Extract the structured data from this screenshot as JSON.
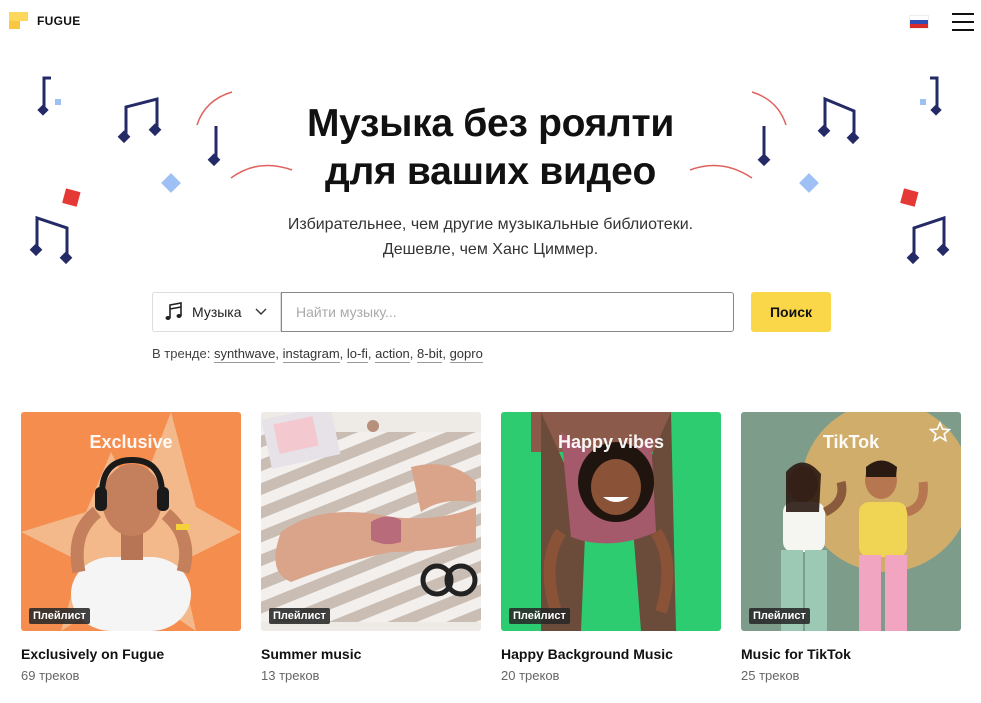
{
  "header": {
    "logo_text": "FUGUE",
    "flag_icon": "russia-flag-icon",
    "menu_icon": "hamburger-menu-icon"
  },
  "hero": {
    "title_line1": "Музыка без роялти",
    "title_line2": "для ваших видео",
    "subtitle_line1": "Избирательнее, чем другие музыкальные библиотеки.",
    "subtitle_line2": "Дешевле, чем Ханс Циммер."
  },
  "search": {
    "category_label": "Музыка",
    "category_icon": "music-note-icon",
    "placeholder": "Найти музыку...",
    "value": "",
    "button_label": "Поиск"
  },
  "trending": {
    "label": "В тренде:",
    "tags": [
      "synthwave",
      "instagram",
      "lo-fi",
      "action",
      "8-bit",
      "gopro"
    ]
  },
  "cards": [
    {
      "overlay": "Exclusive",
      "tag": "Плейлист",
      "title": "Exclusively on Fugue",
      "count": "69 треков"
    },
    {
      "overlay": "",
      "tag": "Плейлист",
      "title": "Summer music",
      "count": "13 треков"
    },
    {
      "overlay": "Happy vibes",
      "tag": "Плейлист",
      "title": "Happy Background Music",
      "count": "20 треков"
    },
    {
      "overlay": "TikTok",
      "tag": "Плейлист",
      "title": "Music for TikTok",
      "count": "25 треков"
    }
  ],
  "colors": {
    "accent_yellow": "#f9d748",
    "navy_note": "#232a66",
    "red_shape": "#e53935",
    "light_blue_shape": "#9fc0f5",
    "card1_bg": "#f58d4e",
    "card3_bg": "#2ecc71",
    "card4_bg": "#7d9d8a"
  }
}
